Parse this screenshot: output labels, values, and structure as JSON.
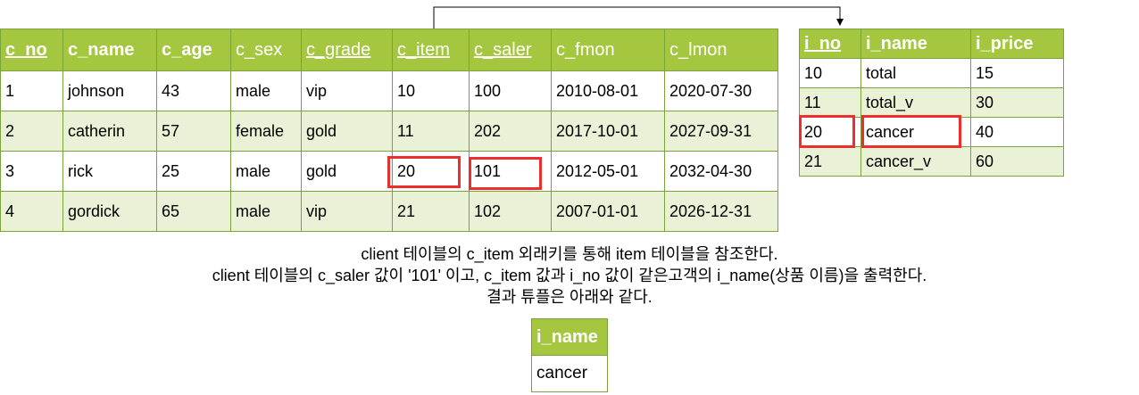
{
  "client_table": {
    "headers": [
      "c_no",
      "c_name",
      "c_age",
      "c_sex",
      "c_grade",
      "c_item",
      "c_saler",
      "c_fmon",
      "c_lmon"
    ],
    "rows": [
      [
        "1",
        "johnson",
        "43",
        "male",
        "vip",
        "10",
        "100",
        "2010-08-01",
        "2020-07-30"
      ],
      [
        "2",
        "catherin",
        "57",
        "female",
        "gold",
        "11",
        "202",
        "2017-10-01",
        "2027-09-31"
      ],
      [
        "3",
        "rick",
        "25",
        "male",
        "gold",
        "20",
        "101",
        "2012-05-01",
        "2032-04-30"
      ],
      [
        "4",
        "gordick",
        "65",
        "male",
        "vip",
        "21",
        "102",
        "2007-01-01",
        "2026-12-31"
      ]
    ]
  },
  "item_table": {
    "headers": [
      "i_no",
      "i_name",
      "i_price"
    ],
    "rows": [
      [
        "10",
        "total",
        "15"
      ],
      [
        "11",
        "total_v",
        "30"
      ],
      [
        "20",
        "cancer",
        "40"
      ],
      [
        "21",
        "cancer_v",
        "60"
      ]
    ]
  },
  "captions": [
    "client 테이블의 c_item 외래키를 통해 item 테이블을 참조한다.",
    "client 테이블의 c_saler 값이 '101' 이고, c_item 값과 i_no 값이 같은고객의 i_name(상품 이름)을 출력한다.",
    "결과 튜플은 아래와 같다."
  ],
  "result_table": {
    "header": "i_name",
    "value": "cancer"
  },
  "colors": {
    "header_bg": "#a5c73f",
    "even_row_bg": "#e9f2d6",
    "highlight": "#ee2d2d"
  }
}
